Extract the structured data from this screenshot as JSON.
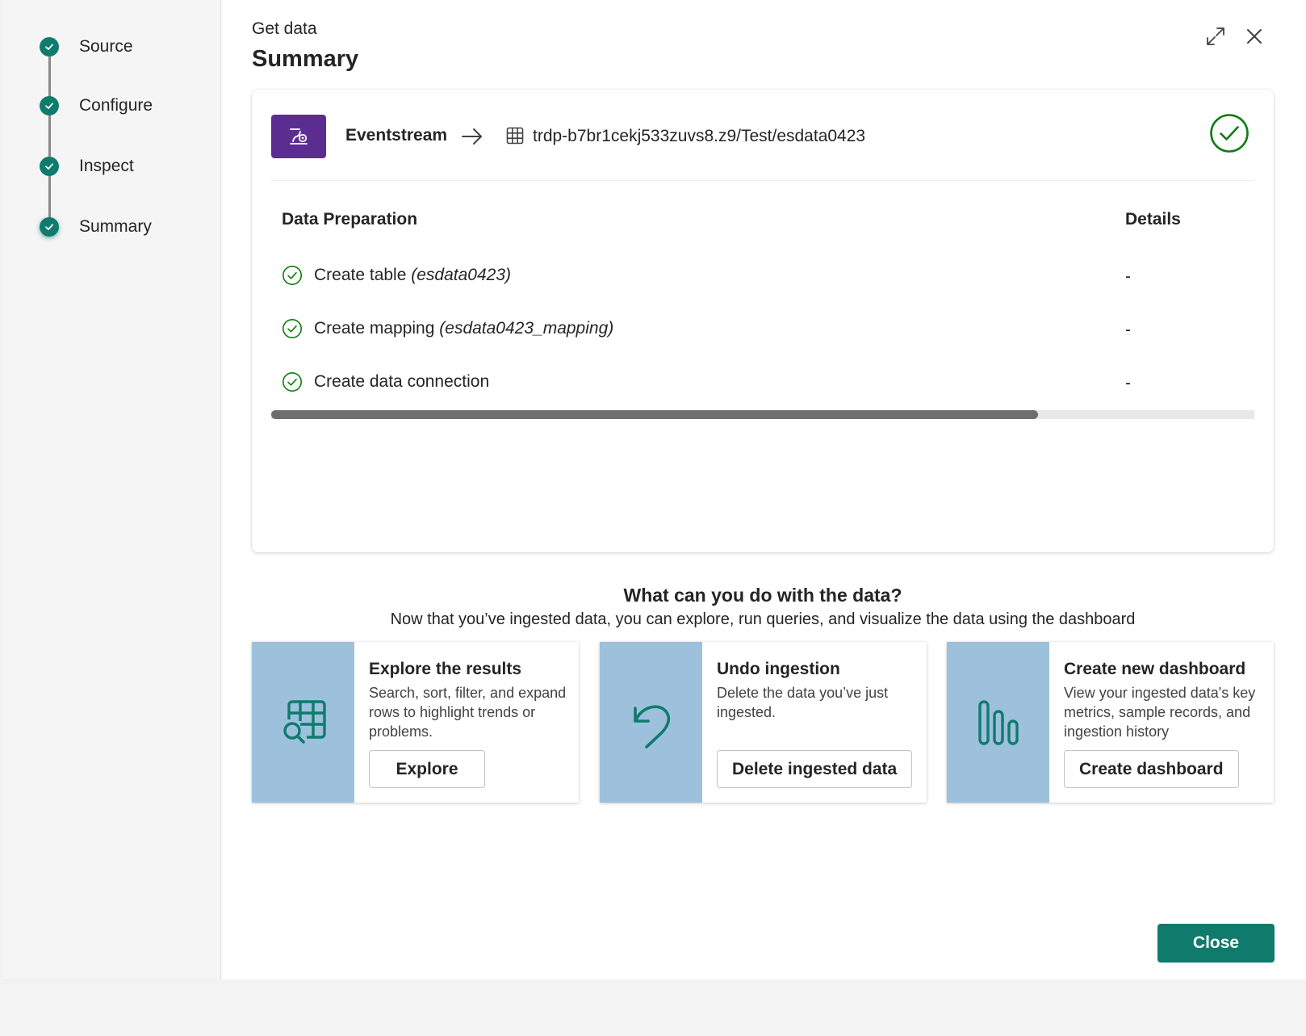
{
  "steps": [
    {
      "label": "Source",
      "status": "complete"
    },
    {
      "label": "Configure",
      "status": "complete"
    },
    {
      "label": "Inspect",
      "status": "complete"
    },
    {
      "label": "Summary",
      "status": "current"
    }
  ],
  "header": {
    "subtitle": "Get data",
    "title": "Summary",
    "expand_icon": "expand-icon",
    "close_icon": "close-icon"
  },
  "summary": {
    "source_label": "Eventstream",
    "source_icon": "eventstream-icon",
    "target_path": "trdp-b7br1cekj533zuvs8.z9/Test/esdata0423",
    "status_icon": "success-check-circle-icon",
    "prep_header": "Data Preparation",
    "details_header": "Details",
    "rows": [
      {
        "label": "Create table",
        "param": "(esdata0423)",
        "detail": "-"
      },
      {
        "label": "Create mapping",
        "param": "(esdata0423_mapping)",
        "detail": "-"
      },
      {
        "label": "Create data connection",
        "param": "",
        "detail": "-"
      }
    ],
    "scroll_fraction": 0.78
  },
  "actions": {
    "title": "What can you do with the data?",
    "subtitle": "Now that you’ve ingested data, you can explore, run queries, and visualize the data using the dashboard",
    "cards": [
      {
        "title": "Explore the results",
        "desc": "Search, sort, filter, and expand rows to highlight trends or problems.",
        "button": "Explore",
        "icon": "table-search-icon"
      },
      {
        "title": "Undo ingestion",
        "desc": "Delete the data you’ve just ingested.",
        "button": "Delete ingested data",
        "icon": "undo-icon"
      },
      {
        "title": "Create new dashboard",
        "desc": "View your ingested data's key metrics, sample records, and ingestion history",
        "button": "Create dashboard",
        "icon": "bar-chart-icon"
      }
    ]
  },
  "footer": {
    "close_label": "Close"
  },
  "colors": {
    "accent": "#0f7b6c",
    "eventstream": "#5c2d91",
    "card_art": "#9dc0dd",
    "success": "#107c10"
  }
}
